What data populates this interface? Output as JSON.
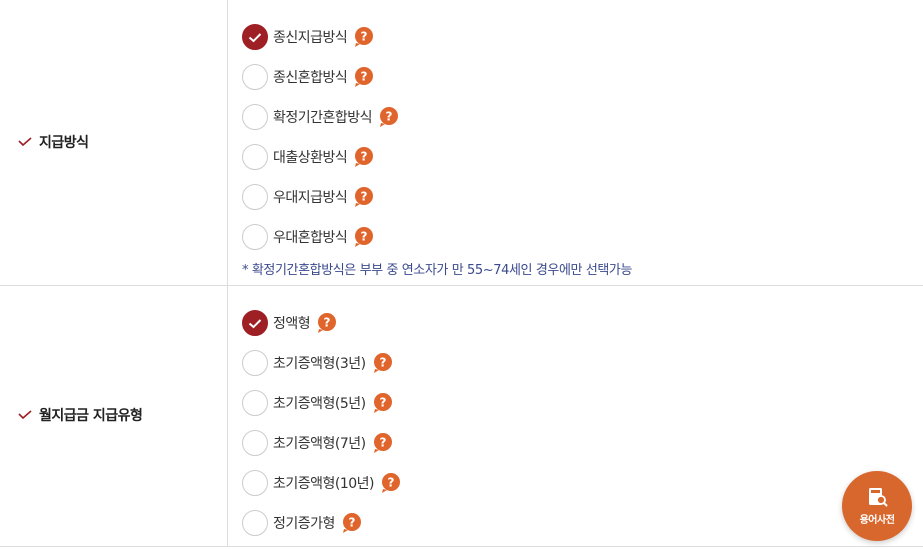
{
  "colors": {
    "accent": "#9e1f24",
    "help": "#e0652c",
    "note": "#3b4a8c",
    "dict_button": "#d8672e"
  },
  "payment_method": {
    "label": "지급방식",
    "options": [
      {
        "label": "종신지급방식",
        "checked": true
      },
      {
        "label": "종신혼합방식",
        "checked": false
      },
      {
        "label": "확정기간혼합방식",
        "checked": false
      },
      {
        "label": "대출상환방식",
        "checked": false
      },
      {
        "label": "우대지급방식",
        "checked": false
      },
      {
        "label": "우대혼합방식",
        "checked": false
      }
    ],
    "note": "* 확정기간혼합방식은 부부 중 연소자가 만 55~74세인 경우에만 선택가능"
  },
  "monthly_type": {
    "label": "월지급금 지급유형",
    "options": [
      {
        "label": "정액형",
        "checked": true
      },
      {
        "label": "초기증액형(3년)",
        "checked": false
      },
      {
        "label": "초기증액형(5년)",
        "checked": false
      },
      {
        "label": "초기증액형(7년)",
        "checked": false
      },
      {
        "label": "초기증액형(10년)",
        "checked": false
      },
      {
        "label": "정기증가형",
        "checked": false
      }
    ]
  },
  "dictionary_button": {
    "label": "용어사전",
    "icon": "book-search-icon"
  }
}
